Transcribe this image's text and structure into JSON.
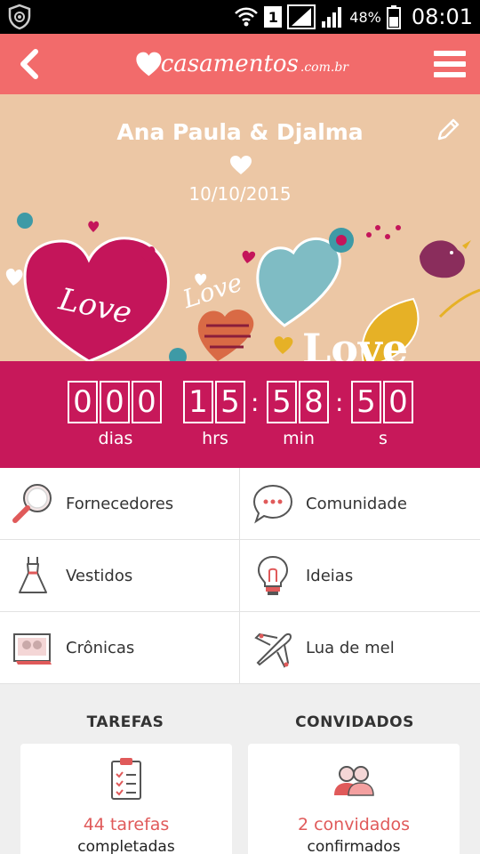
{
  "status_bar": {
    "sim_slot": "1",
    "battery_percent": "48%",
    "time": "08:01"
  },
  "app_bar": {
    "logo_word": "casamentos",
    "logo_tld": ".com.br"
  },
  "hero": {
    "couple_names": "Ana Paula & Djalma",
    "wedding_date": "10/10/2015"
  },
  "countdown": {
    "days": [
      "0",
      "0",
      "0"
    ],
    "hours": [
      "1",
      "5"
    ],
    "minutes": [
      "5",
      "8"
    ],
    "seconds": [
      "5",
      "0"
    ],
    "labels": {
      "days": "dias",
      "hours": "hrs",
      "minutes": "min",
      "seconds": "s"
    }
  },
  "menu_grid": [
    {
      "label": "Fornecedores",
      "icon": "magnifier-icon"
    },
    {
      "label": "Comunidade",
      "icon": "chat-bubble-icon"
    },
    {
      "label": "Vestidos",
      "icon": "dress-icon"
    },
    {
      "label": "Ideias",
      "icon": "lightbulb-icon"
    },
    {
      "label": "Crônicas",
      "icon": "photo-album-icon"
    },
    {
      "label": "Lua de mel",
      "icon": "airplane-icon"
    }
  ],
  "tasks": {
    "title": "TAREFAS",
    "count_text": "44 tarefas",
    "status_text": "completadas"
  },
  "guests": {
    "title": "CONVIDADOS",
    "count_text": "2 convidados",
    "status_text": "confirmados"
  },
  "colors": {
    "app_bar": "#f26b6b",
    "hero_background": "#ecc7a5",
    "countdown_background": "#c7185a",
    "accent_text": "#e05a5a"
  }
}
